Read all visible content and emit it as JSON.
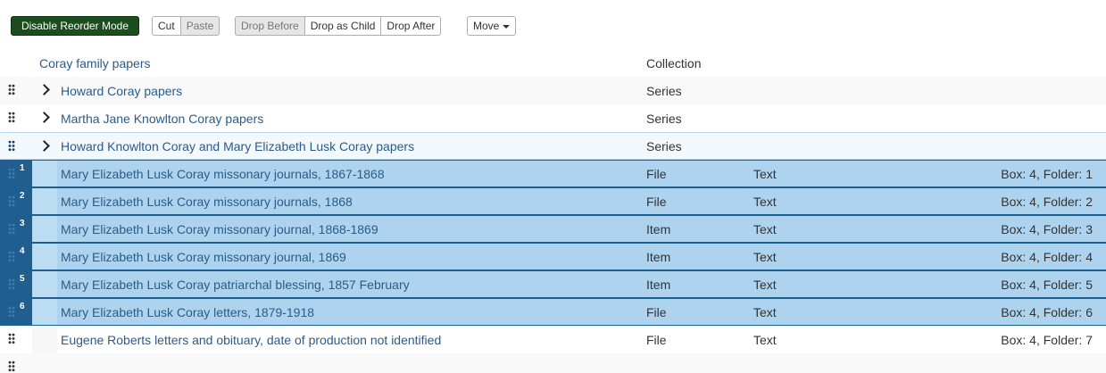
{
  "toolbar": {
    "reorder_label": "Disable Reorder Mode",
    "cut_label": "Cut",
    "paste_label": "Paste",
    "drop_before_label": "Drop Before",
    "drop_as_child_label": "Drop as Child",
    "drop_after_label": "Drop After",
    "move_label": "Move"
  },
  "tree": {
    "root": {
      "title": "Coray family papers",
      "level": "Collection"
    },
    "series": [
      {
        "title": "Howard Coray papers",
        "level": "Series"
      },
      {
        "title": "Martha Jane Knowlton Coray papers",
        "level": "Series"
      },
      {
        "title": "Howard Knowlton Coray and Mary Elizabeth Lusk Coray papers",
        "level": "Series"
      }
    ],
    "children": [
      {
        "badge": "1",
        "title": "Mary Elizabeth Lusk Coray missonary journals, 1867-1868",
        "level": "File",
        "type": "Text",
        "container": "Box: 4, Folder: 1"
      },
      {
        "badge": "2",
        "title": "Mary Elizabeth Lusk Coray missonary journals, 1868",
        "level": "File",
        "type": "Text",
        "container": "Box: 4, Folder: 2"
      },
      {
        "badge": "3",
        "title": "Mary Elizabeth Lusk Coray missonary journal, 1868-1869",
        "level": "Item",
        "type": "Text",
        "container": "Box: 4, Folder: 3"
      },
      {
        "badge": "4",
        "title": "Mary Elizabeth Lusk Coray missonary journal, 1869",
        "level": "Item",
        "type": "Text",
        "container": "Box: 4, Folder: 4"
      },
      {
        "badge": "5",
        "title": "Mary Elizabeth Lusk Coray patriarchal blessing, 1857 February",
        "level": "Item",
        "type": "Text",
        "container": "Box: 4, Folder: 5"
      },
      {
        "badge": "6",
        "title": "Mary Elizabeth Lusk Coray letters, 1879-1918",
        "level": "File",
        "type": "Text",
        "container": "Box: 4, Folder: 6"
      },
      {
        "badge": "",
        "title": "Eugene Roberts letters and obituary, date of production not identified",
        "level": "File",
        "type": "Text",
        "container": "Box: 4, Folder: 7"
      }
    ]
  }
}
